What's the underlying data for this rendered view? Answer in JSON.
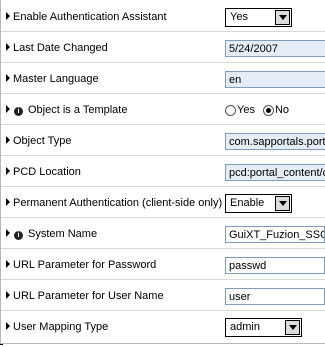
{
  "properties": [
    {
      "label": "Enable Authentication Assistant",
      "type": "select",
      "value": "Yes"
    },
    {
      "label": "Last Date Changed",
      "type": "readonly",
      "value": "5/24/2007"
    },
    {
      "label": "Master Language",
      "type": "readonly",
      "value": "en"
    },
    {
      "label": "Object is a Template",
      "type": "radio",
      "info_icon": true,
      "options": [
        "Yes",
        "No"
      ],
      "selected": "No"
    },
    {
      "label": "Object Type",
      "type": "readonly",
      "value": "com.sapportals.portal.unifier"
    },
    {
      "label": "PCD Location",
      "type": "readonly",
      "value": "pcd:portal_content/com"
    },
    {
      "label": "Permanent Authentication (client-side only)",
      "type": "select",
      "value": "Enable"
    },
    {
      "label": "System Name",
      "type": "text",
      "info_icon": true,
      "value": "GuiXT_Fuzion_SSO"
    },
    {
      "label": "URL Parameter for Password",
      "type": "text",
      "value": "passwd"
    },
    {
      "label": "URL Parameter for User Name",
      "type": "text",
      "value": "user"
    },
    {
      "label": "User Mapping Type",
      "type": "select",
      "value": "admin"
    }
  ]
}
